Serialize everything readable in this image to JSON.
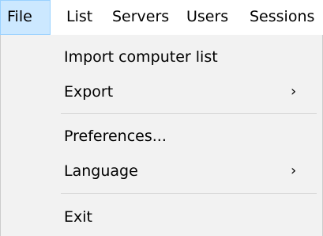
{
  "menubar": {
    "items": [
      {
        "label": "File",
        "active": true
      },
      {
        "label": "List"
      },
      {
        "label": "Servers"
      },
      {
        "label": "Users"
      },
      {
        "label": "Sessions"
      }
    ]
  },
  "file_menu": {
    "items": [
      {
        "label": "Import computer list"
      },
      {
        "label": "Export",
        "submenu_arrow": "›"
      },
      {
        "label": "Preferences..."
      },
      {
        "label": "Language",
        "submenu_arrow": "›"
      },
      {
        "label": "Exit"
      }
    ]
  },
  "colors": {
    "active_menu_bg": "#cce8ff",
    "active_menu_border": "#99d1ff",
    "dropdown_bg": "#f2f2f2",
    "separator": "#d7d7d7"
  }
}
